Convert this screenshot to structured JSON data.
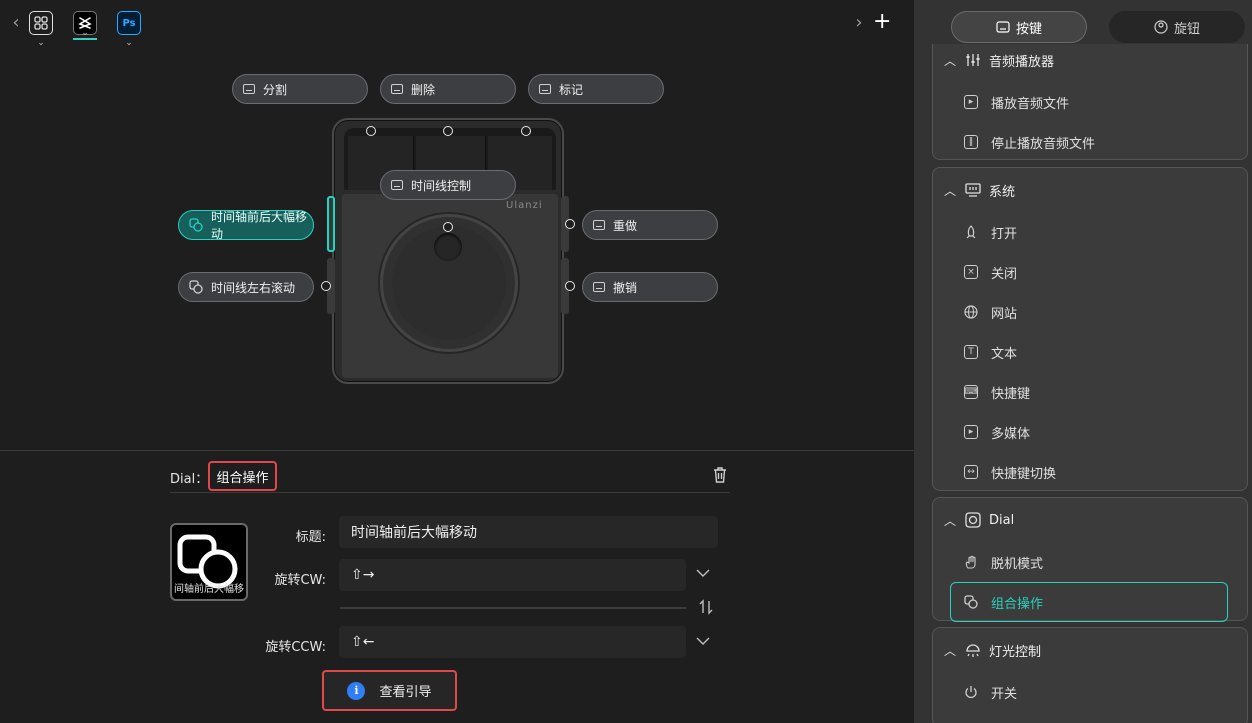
{
  "topbar": {
    "back_icon": "chevron-left-icon",
    "forward_icon": "chevron-right-icon",
    "add_icon": "plus-icon",
    "apps": [
      {
        "name": "grid-icon",
        "chevron": "⌄"
      },
      {
        "name": "capcut-icon",
        "chevron": "⌄"
      },
      {
        "name": "ps-icon",
        "label": "Ps",
        "chevron": "⌄"
      }
    ]
  },
  "device": {
    "brand": "Ulanzi",
    "keys": {
      "k1": "分割",
      "k2": "删除",
      "k3": "标记",
      "k4": "时间线控制",
      "left_top": "时间轴前后大幅移动",
      "left_bottom": "时间线左右滚动",
      "right_top": "重做",
      "right_bottom": "撤销"
    }
  },
  "editor": {
    "dial_label": "Dial：",
    "dial_type": "组合操作",
    "preview_caption": "间轴前后大幅移",
    "title_label": "标题:",
    "title_value": "时间轴前后大幅移动",
    "cw_label": "旋转CW:",
    "cw_value": "⇧→",
    "ccw_label": "旋转CCW:",
    "ccw_value": "⇧←",
    "guide_button": "查看引导",
    "info_glyph": "i"
  },
  "sidebar": {
    "tabs": {
      "keys": "按键",
      "dials": "旋钮"
    },
    "groups": {
      "audio": {
        "title": "音频播放器",
        "items": [
          "播放音频文件",
          "停止播放音频文件"
        ]
      },
      "system": {
        "title": "系统",
        "items": [
          "打开",
          "关闭",
          "网站",
          "文本",
          "快捷键",
          "多媒体",
          "快捷键切换"
        ]
      },
      "dial": {
        "title": "Dial",
        "items": [
          "脱机模式",
          "组合操作"
        ]
      },
      "light": {
        "title": "灯光控制",
        "items": [
          "开关"
        ]
      }
    }
  },
  "colors": {
    "accent": "#2ad1c0",
    "highlight_red": "#e0484a",
    "info_blue": "#2f7ef5",
    "background": "#1e1e1e",
    "sidebar": "#333333"
  }
}
